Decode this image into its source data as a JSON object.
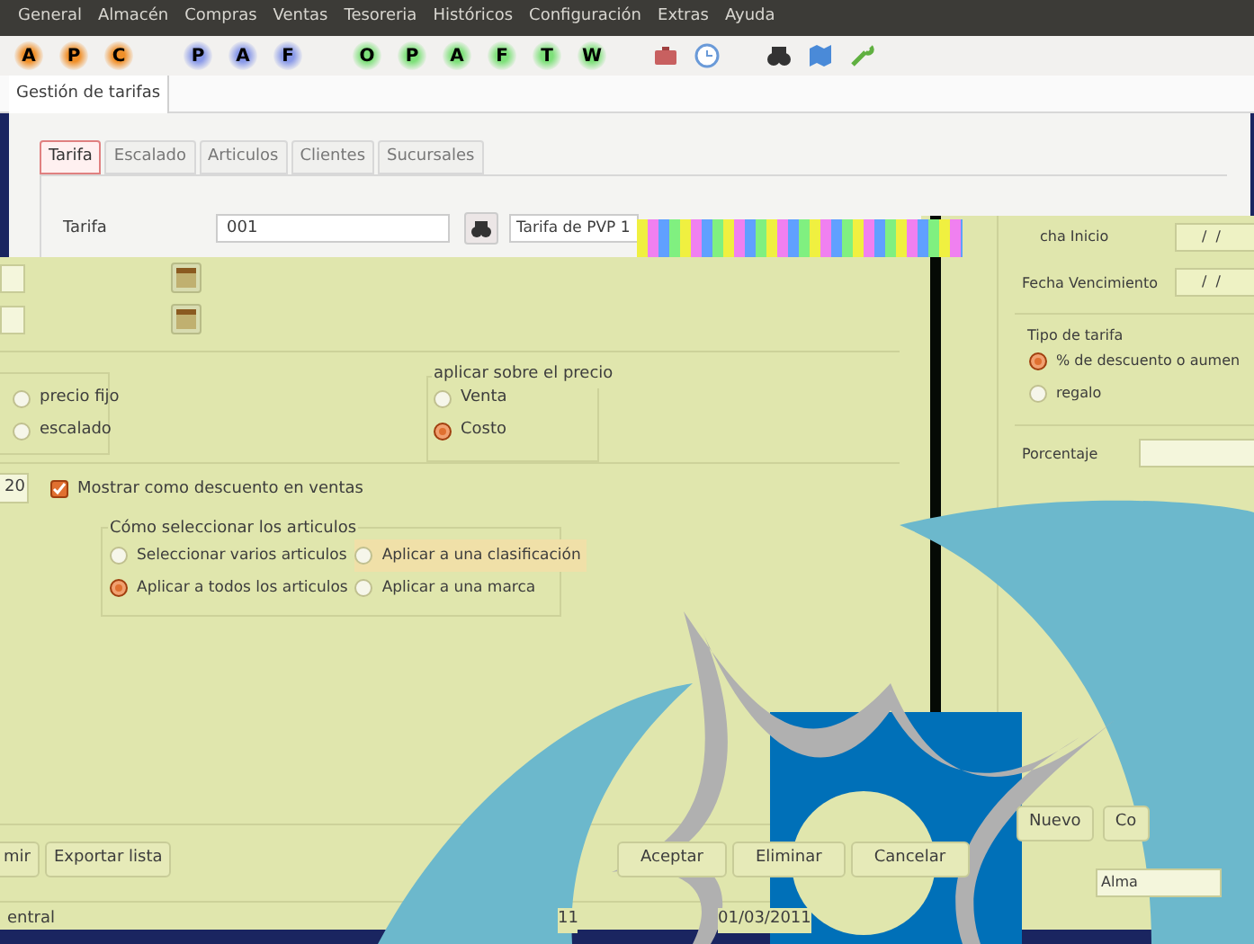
{
  "menu_bar": [
    "General",
    "Almacén",
    "Compras",
    "Ventas",
    "Tesoreria",
    "Históricos",
    "Configuración",
    "Extras",
    "Ayuda"
  ],
  "toolbar": [
    {
      "label": "A",
      "color": "#f0902a"
    },
    {
      "label": "P",
      "color": "#f0902a"
    },
    {
      "label": "C",
      "color": "#f0902a"
    },
    {
      "label": "P",
      "color": "#8a9ae8"
    },
    {
      "label": "A",
      "color": "#8a9ae8"
    },
    {
      "label": "F",
      "color": "#8a9ae8"
    },
    {
      "label": "O",
      "color": "#7ee07a"
    },
    {
      "label": "P",
      "color": "#7ee07a"
    },
    {
      "label": "A",
      "color": "#7ee07a"
    },
    {
      "label": "F",
      "color": "#7ee07a"
    },
    {
      "label": "T",
      "color": "#7ee07a"
    },
    {
      "label": "W",
      "color": "#7ee07a"
    }
  ],
  "document_tab": {
    "label": "Gestión de tarifas",
    "selected": true
  },
  "tabs": [
    {
      "label": "Tarifa",
      "selected": true
    },
    {
      "label": "Escalado",
      "selected": false
    },
    {
      "label": "Articulos",
      "selected": false
    },
    {
      "label": "Clientes",
      "selected": false
    },
    {
      "label": "Sucursales",
      "selected": false
    }
  ],
  "tarifa": {
    "label": "Tarifa",
    "code": "001",
    "name": "Tarifa de PVP 1"
  },
  "tipo_radios": [
    {
      "label": "precio fijo",
      "selected": false
    },
    {
      "label": "escalado",
      "selected": false
    }
  ],
  "aplicar": {
    "title": "aplicar sobre el precio",
    "options": [
      {
        "label": "Venta",
        "selected": false
      },
      {
        "label": "Costo",
        "selected": true
      }
    ]
  },
  "discount": {
    "value": "20",
    "checkbox": {
      "label": "Mostrar como descuento en ventas",
      "checked": true
    }
  },
  "seleccion": {
    "title": "Cómo seleccionar los articulos",
    "options": [
      {
        "label": "Seleccionar varios articulos",
        "selected": false,
        "hovered": false
      },
      {
        "label": "Aplicar a una clasificación",
        "selected": false,
        "hovered": true
      },
      {
        "label": "Aplicar a todos los articulos",
        "selected": true,
        "hovered": false
      },
      {
        "label": "Aplicar a una marca",
        "selected": false,
        "hovered": false
      }
    ]
  },
  "buttons_left": [
    "mir",
    "Exportar lista"
  ],
  "buttons_right": [
    "Aceptar",
    "Eliminar",
    "Cancelar"
  ],
  "status_bar": [
    "entral",
    "11",
    "01/03/2011"
  ],
  "second_window": {
    "fecha_inicio": {
      "label": "cha Inicio",
      "value": "/  /"
    },
    "fecha_vencimiento": {
      "label": "Fecha Vencimiento",
      "value": "/  /"
    },
    "tipo_de_tarifa": {
      "title": "Tipo de tarifa",
      "options": [
        {
          "label": "% de descuento o aumen",
          "selected": true
        },
        {
          "label": "regalo",
          "selected": false
        }
      ]
    },
    "porcentaje": {
      "label": "Porcentaje"
    },
    "buttons": [
      "Nuevo",
      "Co"
    ],
    "field_value": "Alma"
  }
}
